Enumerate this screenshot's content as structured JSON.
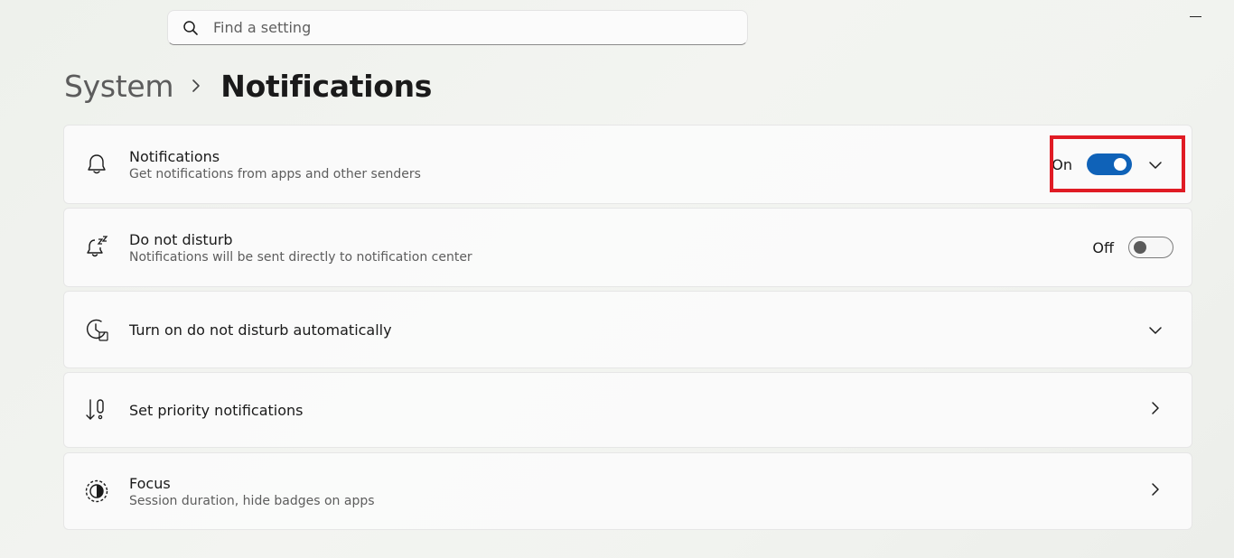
{
  "search": {
    "placeholder": "Find a setting",
    "icon": "search-icon"
  },
  "window": {
    "minimize_icon": "minimize-icon"
  },
  "breadcrumb": {
    "parent": "System",
    "current": "Notifications"
  },
  "cards": {
    "notifications": {
      "title": "Notifications",
      "subtitle": "Get notifications from apps and other senders",
      "state": "On",
      "toggle_on": true,
      "icon": "bell-icon"
    },
    "dnd": {
      "title": "Do not disturb",
      "subtitle": "Notifications will be sent directly to notification center",
      "state": "Off",
      "toggle_on": false,
      "icon": "bell-snooze-icon"
    },
    "auto_dnd": {
      "title": "Turn on do not disturb automatically",
      "icon": "clock-icon"
    },
    "priority": {
      "title": "Set priority notifications",
      "icon": "priority-icon"
    },
    "focus": {
      "title": "Focus",
      "subtitle": "Session duration, hide badges on apps",
      "icon": "focus-icon"
    }
  },
  "colors": {
    "accent": "#0f62b8",
    "highlight": "#e01b24"
  }
}
